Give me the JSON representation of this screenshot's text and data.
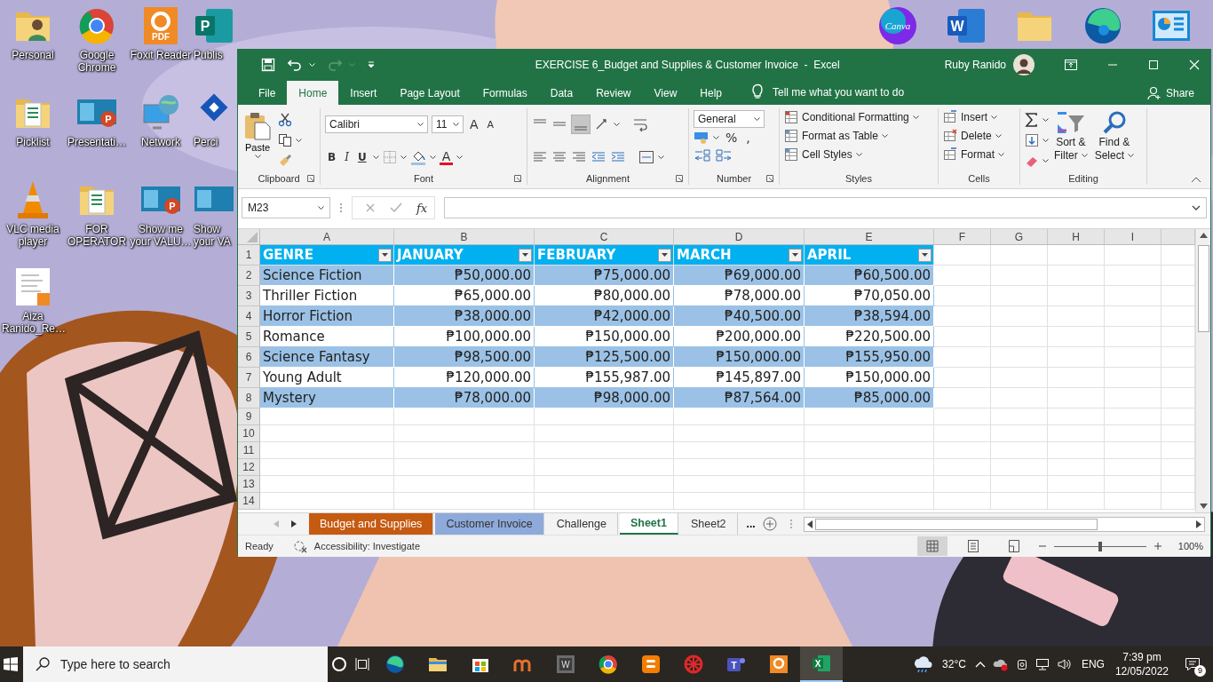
{
  "desktop_left": [
    {
      "label": "Personal",
      "kind": "person-folder"
    },
    {
      "label": "Google Chrome",
      "kind": "browser"
    },
    {
      "label": "Foxit Reader",
      "kind": "pdf",
      "badge": "PDF"
    },
    {
      "label": "Publis",
      "kind": "tile",
      "badge": "P"
    },
    {
      "label": "Picklist",
      "kind": "doc-folder"
    },
    {
      "label": "Presentati…",
      "kind": "slides",
      "badge": "P"
    },
    {
      "label": "Network",
      "kind": "network"
    },
    {
      "label": "Perci",
      "kind": "diamond"
    },
    {
      "label": "VLC media player",
      "kind": "cone"
    },
    {
      "label": "FOR OPERATOR",
      "kind": "doc-folder"
    },
    {
      "label": "Show me your VALU…",
      "kind": "slides",
      "badge": "P"
    },
    {
      "label": "Show your VA",
      "kind": "slides2"
    },
    {
      "label": "Aiza Ranido_Re…",
      "kind": "document"
    }
  ],
  "desktop_right": [
    {
      "kind": "circle-logo",
      "badge": "Canva"
    },
    {
      "kind": "tile",
      "badge": "W"
    },
    {
      "kind": "folder"
    },
    {
      "kind": "swirl"
    },
    {
      "kind": "dashboard"
    }
  ],
  "window": {
    "title": "EXERCISE 6_Budget and Supplies & Customer Invoice  -  Excel",
    "user": "Ruby Ranido"
  },
  "menu_tabs": [
    {
      "label": "File",
      "selected": false
    },
    {
      "label": "Home",
      "selected": true
    },
    {
      "label": "Insert",
      "selected": false
    },
    {
      "label": "Page Layout",
      "selected": false
    },
    {
      "label": "Formulas",
      "selected": false
    },
    {
      "label": "Data",
      "selected": false
    },
    {
      "label": "Review",
      "selected": false
    },
    {
      "label": "View",
      "selected": false
    },
    {
      "label": "Help",
      "selected": false
    }
  ],
  "tell_me": "Tell me what you want to do",
  "share": "Share",
  "ribbon": {
    "clipboard": {
      "paste": "Paste",
      "label": "Clipboard"
    },
    "font": {
      "name": "Calibri",
      "size": "11",
      "grow": "A",
      "shrink": "A",
      "bold": "B",
      "italic": "I",
      "underline": "U",
      "color_letter": "A",
      "label": "Font"
    },
    "alignment": {
      "label": "Alignment"
    },
    "number": {
      "format": "General",
      "percent": "%",
      "comma": ",",
      "label": "Number"
    },
    "styles": {
      "buttons": [
        "Conditional Formatting",
        "Format as Table",
        "Cell Styles"
      ],
      "label": "Styles"
    },
    "cells": {
      "buttons": [
        "Insert",
        "Delete",
        "Format"
      ],
      "label": "Cells"
    },
    "editing": {
      "sort_filter": [
        "Sort &",
        "Filter"
      ],
      "find_select": [
        "Find &",
        "Select"
      ],
      "label": "Editing"
    }
  },
  "name_box": "M23",
  "fx": "fx",
  "columns": [
    "A",
    "B",
    "C",
    "D",
    "E",
    "F",
    "G",
    "H",
    "I"
  ],
  "row_numbers": [
    "1",
    "2",
    "3",
    "4",
    "5",
    "6",
    "7",
    "8",
    "9",
    "10",
    "11",
    "12",
    "13",
    "14"
  ],
  "table": {
    "headers": [
      "GENRE",
      "JANUARY",
      "FEBRUARY",
      "MARCH",
      "APRIL"
    ],
    "rows": [
      [
        "Science Fiction",
        "₱50,000.00",
        "₱75,000.00",
        "₱69,000.00",
        "₱60,500.00"
      ],
      [
        "Thriller Fiction",
        "₱65,000.00",
        "₱80,000.00",
        "₱78,000.00",
        "₱70,050.00"
      ],
      [
        "Horror Fiction",
        "₱38,000.00",
        "₱42,000.00",
        "₱40,500.00",
        "₱38,594.00"
      ],
      [
        "Romance",
        "₱100,000.00",
        "₱150,000.00",
        "₱200,000.00",
        "₱220,500.00"
      ],
      [
        "Science Fantasy",
        "₱98,500.00",
        "₱125,500.00",
        "₱150,000.00",
        "₱155,950.00"
      ],
      [
        "Young Adult",
        "₱120,000.00",
        "₱155,987.00",
        "₱145,897.00",
        "₱150,000.00"
      ],
      [
        "Mystery",
        "₱78,000.00",
        "₱98,000.00",
        "₱87,564.00",
        "₱85,000.00"
      ]
    ]
  },
  "sheet_tabs": [
    {
      "label": "Budget and Supplies",
      "selected": false,
      "color": "#c55a11"
    },
    {
      "label": "Customer Invoice",
      "selected": false,
      "color": "#8eaadb"
    },
    {
      "label": "Challenge",
      "selected": false
    },
    {
      "label": "Sheet1",
      "selected": true
    },
    {
      "label": "Sheet2",
      "selected": false
    }
  ],
  "more_sheets": "...",
  "status": "Ready",
  "accessibility": "Accessibility: Investigate",
  "zoom": "100%",
  "zoom_slider": {
    "level": 0.5
  },
  "taskbar": {
    "search_placeholder": "Type here to search",
    "apps": [
      {
        "kind": "edge",
        "selected": false
      },
      {
        "kind": "folder",
        "selected": false
      },
      {
        "kind": "store",
        "selected": false
      },
      {
        "kind": "arcs",
        "selected": false
      },
      {
        "kind": "tile",
        "badge": "W",
        "selected": false
      },
      {
        "kind": "browser",
        "selected": false
      },
      {
        "kind": "blog",
        "selected": false
      },
      {
        "kind": "wheel",
        "selected": false
      },
      {
        "kind": "team",
        "badge": "T",
        "selected": false
      },
      {
        "kind": "pdf",
        "selected": false
      },
      {
        "kind": "sheet",
        "badge": "X",
        "selected": true
      }
    ],
    "temperature": "32°C",
    "language": "ENG",
    "time": "7:39 pm",
    "date": "12/05/2022",
    "notifications": "9"
  }
}
